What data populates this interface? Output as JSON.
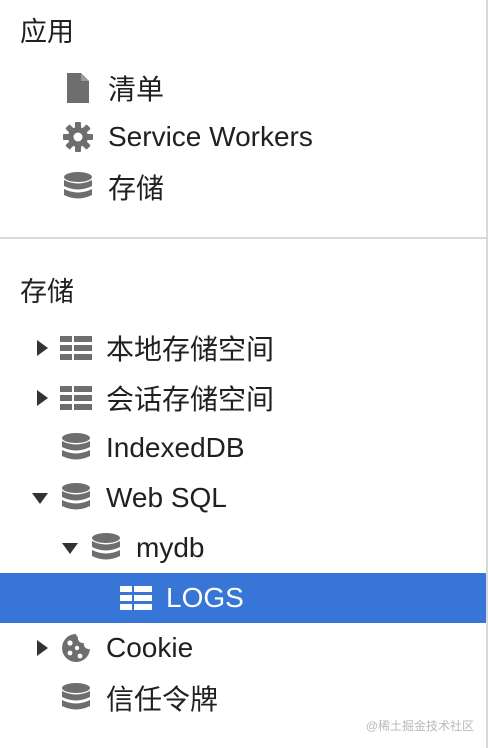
{
  "application": {
    "title": "应用",
    "items": [
      {
        "label": "清单",
        "icon": "document-icon"
      },
      {
        "label": "Service Workers",
        "icon": "gear-icon"
      },
      {
        "label": "存储",
        "icon": "database-icon"
      }
    ]
  },
  "storage": {
    "title": "存储",
    "items": [
      {
        "label": "本地存储空间",
        "icon": "table-icon",
        "expander": "collapsed"
      },
      {
        "label": "会话存储空间",
        "icon": "table-icon",
        "expander": "collapsed"
      },
      {
        "label": "IndexedDB",
        "icon": "database-icon"
      },
      {
        "label": "Web SQL",
        "icon": "database-icon",
        "expander": "expanded"
      },
      {
        "label": "mydb",
        "icon": "database-icon",
        "expander": "expanded"
      },
      {
        "label": "LOGS",
        "icon": "table-icon",
        "selected": true
      },
      {
        "label": "Cookie",
        "icon": "cookie-icon",
        "expander": "collapsed"
      },
      {
        "label": "信任令牌",
        "icon": "database-icon"
      }
    ]
  },
  "watermark": "@稀土掘金技术社区",
  "colors": {
    "selection": "#3776d6",
    "icon": "#6e6e6e",
    "text": "#202020"
  }
}
